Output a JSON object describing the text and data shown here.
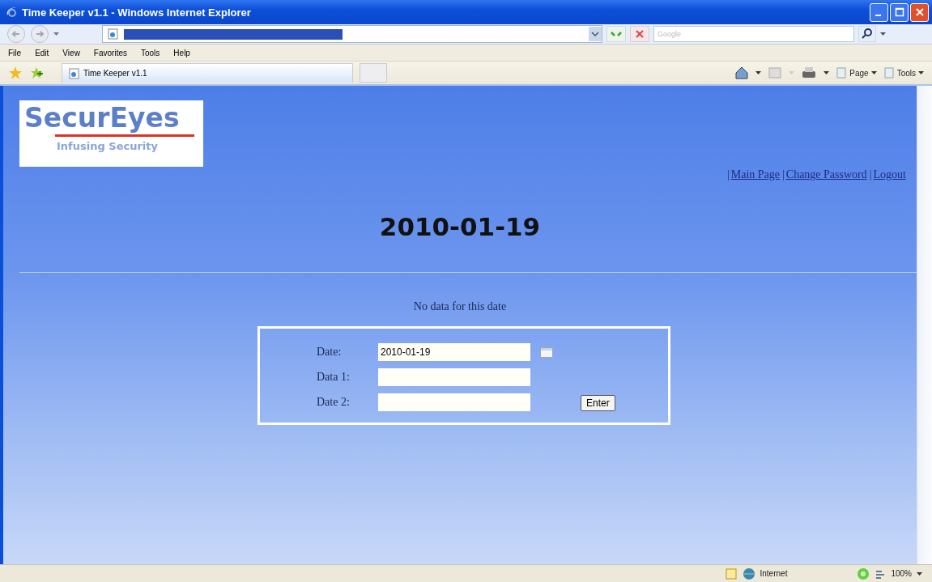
{
  "window": {
    "title": "Time Keeper v1.1 - Windows Internet Explorer"
  },
  "search": {
    "placeholder": "Google"
  },
  "menu": [
    "File",
    "Edit",
    "View",
    "Favorites",
    "Tools",
    "Help"
  ],
  "tabs": [
    {
      "label": "Time Keeper v1.1",
      "selected": true
    }
  ],
  "command_bar": [
    {
      "label": "Page"
    },
    {
      "label": "Tools"
    }
  ],
  "page": {
    "logo": {
      "name": "SecurEyes",
      "tagline": "Infusing Security"
    },
    "nav": {
      "separator": "|",
      "links": [
        "Main Page",
        "Change Password",
        "Logout"
      ]
    },
    "heading": "2010-01-19",
    "message": "No data for this date",
    "form": {
      "fields": [
        {
          "label": "Date:",
          "value": "2010-01-19",
          "calendar": true
        },
        {
          "label": "Data 1:",
          "calendar": false
        },
        {
          "label": "Date 2:",
          "calendar": false
        }
      ],
      "submit": "Enter"
    }
  },
  "status_bar": {
    "zone": "Internet",
    "zoom": "100%"
  }
}
